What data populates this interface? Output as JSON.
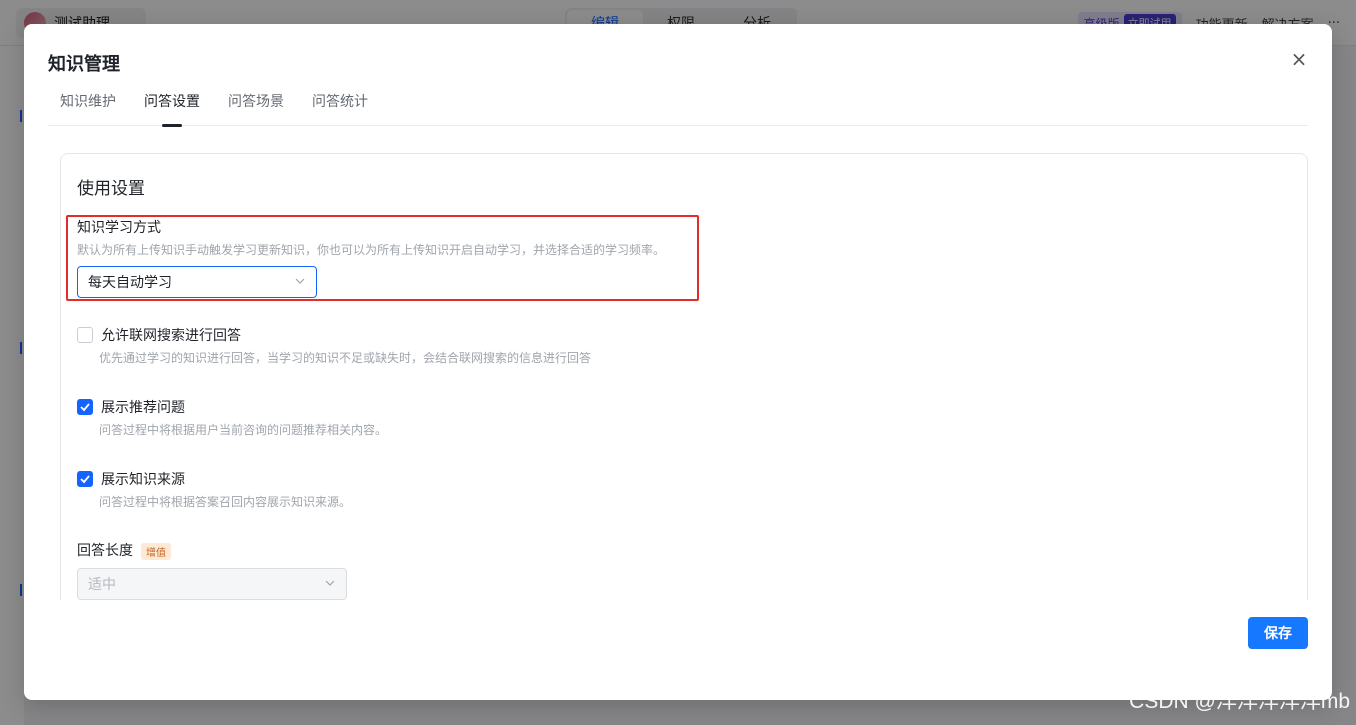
{
  "background": {
    "assistant_name": "测试助理",
    "top_tabs": [
      "编辑",
      "权限",
      "分析"
    ],
    "pro_label": "高级版",
    "pro_tag": "立即试用",
    "links": [
      "功能更新",
      "解决方案"
    ],
    "more": "···"
  },
  "modal": {
    "title": "知识管理",
    "close_symbol": "×",
    "tabs": [
      {
        "label": "知识维护",
        "active": false
      },
      {
        "label": "问答设置",
        "active": true
      },
      {
        "label": "问答场景",
        "active": false
      },
      {
        "label": "问答统计",
        "active": false
      }
    ],
    "section_title": "使用设置",
    "learning": {
      "label": "知识学习方式",
      "description": "默认为所有上传知识手动触发学习更新知识，你也可以为所有上传知识开启自动学习，并选择合适的学习频率。",
      "selected": "每天自动学习"
    },
    "options": [
      {
        "label": "允许联网搜索进行回答",
        "description": "优先通过学习的知识进行回答，当学习的知识不足或缺失时，会结合联网搜索的信息进行回答",
        "checked": false
      },
      {
        "label": "展示推荐问题",
        "description": "问答过程中将根据用户当前咨询的问题推荐相关内容。",
        "checked": true
      },
      {
        "label": "展示知识来源",
        "description": "问答过程中将根据答案召回内容展示知识来源。",
        "checked": true
      }
    ],
    "answer_length": {
      "label": "回答长度",
      "badge": "增值",
      "selected": "适中"
    },
    "save_label": "保存"
  },
  "watermark": "CSDN @洋洋洋洋洋mb",
  "colors": {
    "accent": "#1664ff",
    "save_button": "#1677ff",
    "highlight": "#e22b2b"
  }
}
